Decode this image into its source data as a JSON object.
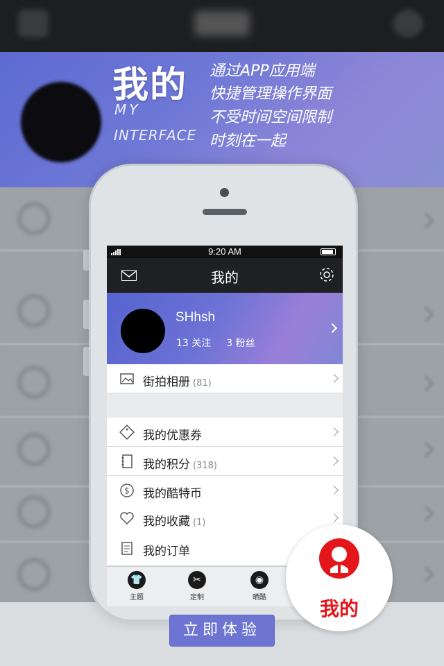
{
  "promo": {
    "headline": "我的",
    "subtitle_line1": "MY",
    "subtitle_line2": "INTERFACE",
    "slogans": [
      "通过APP应用端",
      "快捷管理操作界面",
      "不受时间空间限制",
      "时刻在一起"
    ]
  },
  "status_bar": {
    "time": "9:20 AM"
  },
  "nav": {
    "title": "我的",
    "left_icon": "mail-icon",
    "right_icon": "gear-icon"
  },
  "profile": {
    "username": "SHhsh",
    "following": "13 关注",
    "followers": "3 粉丝"
  },
  "menu": [
    {
      "label": "街拍相册",
      "count": "(81)",
      "icon": "photo-album-icon"
    },
    {
      "label": "我的优惠券",
      "count": "",
      "icon": "coupon-icon"
    },
    {
      "label": "我的积分",
      "count": "(318)",
      "icon": "notebook-icon"
    },
    {
      "label": "我的酷特币",
      "count": "",
      "icon": "dollar-coin-icon"
    },
    {
      "label": "我的收藏",
      "count": "(1)",
      "icon": "heart-icon"
    },
    {
      "label": "我的订单",
      "count": "",
      "icon": "clipboard-icon"
    }
  ],
  "tabbar": [
    {
      "label": "主题",
      "icon": "shirt-icon"
    },
    {
      "label": "定制",
      "icon": "scissors-icon"
    },
    {
      "label": "晒酷",
      "icon": "camera-icon"
    }
  ],
  "badge": {
    "label": "我的",
    "icon": "user-avatar-icon",
    "color": "#e3161b"
  },
  "cta": {
    "label": "立即体验"
  },
  "colors": {
    "accent": "#6d74d2",
    "banner": "#5d6ad0",
    "badge_red": "#e3161b"
  }
}
